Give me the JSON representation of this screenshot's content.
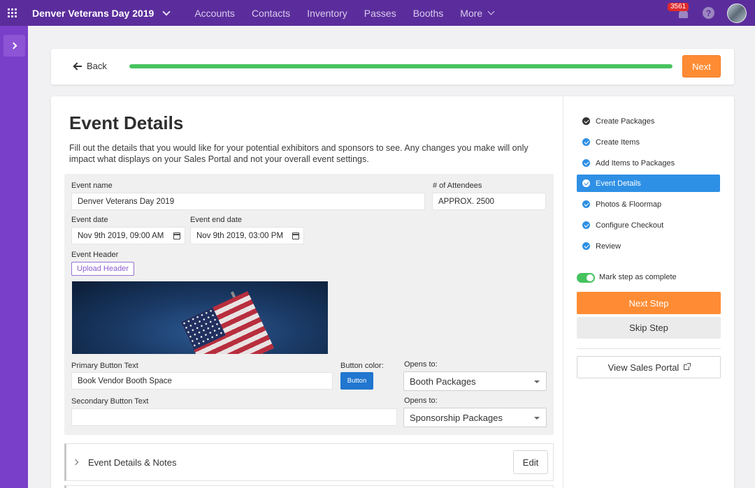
{
  "topbar": {
    "event_title": "Denver Veterans Day 2019",
    "nav": [
      "Accounts",
      "Contacts",
      "Inventory",
      "Passes",
      "Booths"
    ],
    "more_label": "More",
    "notification_count": "3561",
    "help_label": "?"
  },
  "progress": {
    "back_label": "Back",
    "percent": 100,
    "next_label": "Next"
  },
  "page": {
    "title": "Event Details",
    "description": "Fill out the details that you would like for your potential exhibitors and sponsors to see. Any changes you make will only impact what displays on your Sales Portal and not your overall event settings."
  },
  "form": {
    "event_name_label": "Event name",
    "event_name_value": "Denver Veterans Day 2019",
    "attendees_label": "# of Attendees",
    "attendees_value": "APPROX. 2500",
    "event_date_label": "Event date",
    "event_date_value": "Nov 9th 2019, 09:00 AM",
    "event_end_label": "Event end date",
    "event_end_value": "Nov 9th 2019, 03:00 PM",
    "header_label": "Event Header",
    "upload_label": "Upload Header",
    "primary_text_label": "Primary Button Text",
    "primary_text_value": "Book Vendor Booth Space",
    "button_color_label": "Button color:",
    "button_swatch_label": "Button",
    "button_color": "#2176cf",
    "opens_to_label": "Opens to:",
    "primary_opens_value": "Booth Packages",
    "secondary_text_label": "Secondary Button Text",
    "secondary_text_value": "",
    "secondary_opens_label": "Opens to:",
    "secondary_opens_value": "Sponsorship Packages"
  },
  "sections": {
    "details_notes_label": "Event Details & Notes",
    "edit_label": "Edit"
  },
  "steps": [
    {
      "label": "Create Packages",
      "state": "done",
      "color": "#333333"
    },
    {
      "label": "Create Items",
      "state": "done",
      "color": "#2e90e5"
    },
    {
      "label": "Add Items to Packages",
      "state": "done",
      "color": "#2e90e5"
    },
    {
      "label": "Event Details",
      "state": "active",
      "color": "#ffffff"
    },
    {
      "label": "Photos & Floormap",
      "state": "done",
      "color": "#2e90e5"
    },
    {
      "label": "Configure Checkout",
      "state": "done",
      "color": "#2e90e5"
    },
    {
      "label": "Review",
      "state": "done",
      "color": "#2e90e5"
    }
  ],
  "sidebar": {
    "mark_complete_label": "Mark step as complete",
    "mark_complete": true,
    "next_step_label": "Next Step",
    "skip_step_label": "Skip Step",
    "view_portal_label": "View Sales Portal"
  },
  "colors": {
    "brand": "#5b2d9c",
    "accent_orange": "#ff8c34",
    "accent_blue": "#2e90e5",
    "success": "#46c35f"
  }
}
